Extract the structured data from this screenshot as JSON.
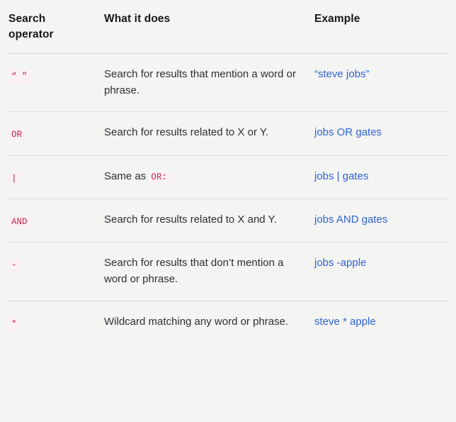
{
  "table": {
    "headers": {
      "operator": "Search operator",
      "what": "What it does",
      "example": "Example"
    },
    "rows": [
      {
        "operator": "“ ”",
        "what_prefix": "Search for results that mention a word or phrase.",
        "what_code": "",
        "what_suffix": "",
        "example": "“steve jobs”"
      },
      {
        "operator": "OR",
        "what_prefix": "Search for results related to X or Y.",
        "what_code": "",
        "what_suffix": "",
        "example": "jobs OR gates"
      },
      {
        "operator": "|",
        "what_prefix": "Same as ",
        "what_code": "OR:",
        "what_suffix": "",
        "example": "jobs | gates"
      },
      {
        "operator": "AND",
        "what_prefix": "Search for results related to X and Y.",
        "what_code": "",
        "what_suffix": "",
        "example": "jobs AND gates"
      },
      {
        "operator": "-",
        "what_prefix": "Search for results that don’t mention a word or phrase.",
        "what_code": "",
        "what_suffix": "",
        "example": "jobs -apple"
      },
      {
        "operator": "*",
        "what_prefix": "Wildcard matching any word or phrase.",
        "what_code": "",
        "what_suffix": "",
        "example": "steve * apple"
      }
    ]
  },
  "colors": {
    "page_background": "#f4f4f3",
    "code_text": "#c7254e",
    "code_background": "#fbf0f3",
    "link": "#2f63d4",
    "divider": "#d9d9d9",
    "header_text": "#17181a",
    "body_text": "#23262a"
  }
}
